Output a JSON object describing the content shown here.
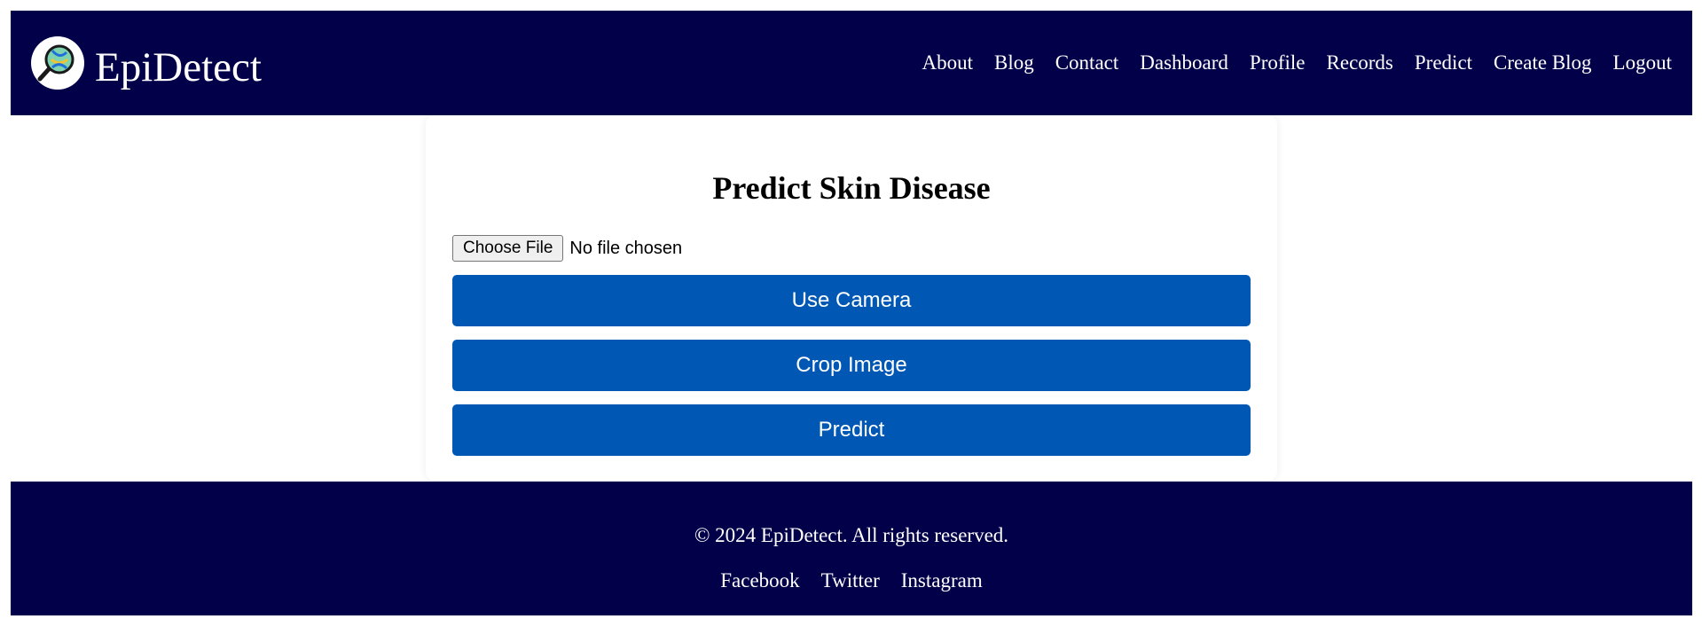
{
  "header": {
    "brand_name": "EpiDetect",
    "logo_icon": "dna-magnifier-logo",
    "nav": [
      {
        "label": "About"
      },
      {
        "label": "Blog"
      },
      {
        "label": "Contact"
      },
      {
        "label": "Dashboard"
      },
      {
        "label": "Profile"
      },
      {
        "label": "Records"
      },
      {
        "label": "Predict"
      },
      {
        "label": "Create Blog"
      },
      {
        "label": "Logout"
      }
    ]
  },
  "main": {
    "title": "Predict Skin Disease",
    "file_input": {
      "button_label": "Choose File",
      "status": "No file chosen"
    },
    "buttons": {
      "camera": "Use Camera",
      "crop": "Crop Image",
      "predict": "Predict"
    }
  },
  "footer": {
    "copyright": "© 2024 EpiDetect. All rights reserved.",
    "social": [
      {
        "label": "Facebook"
      },
      {
        "label": "Twitter"
      },
      {
        "label": "Instagram"
      }
    ]
  },
  "colors": {
    "header_bg": "#03004a",
    "button_bg": "#0058b4",
    "text_on_dark": "#ffffff"
  }
}
